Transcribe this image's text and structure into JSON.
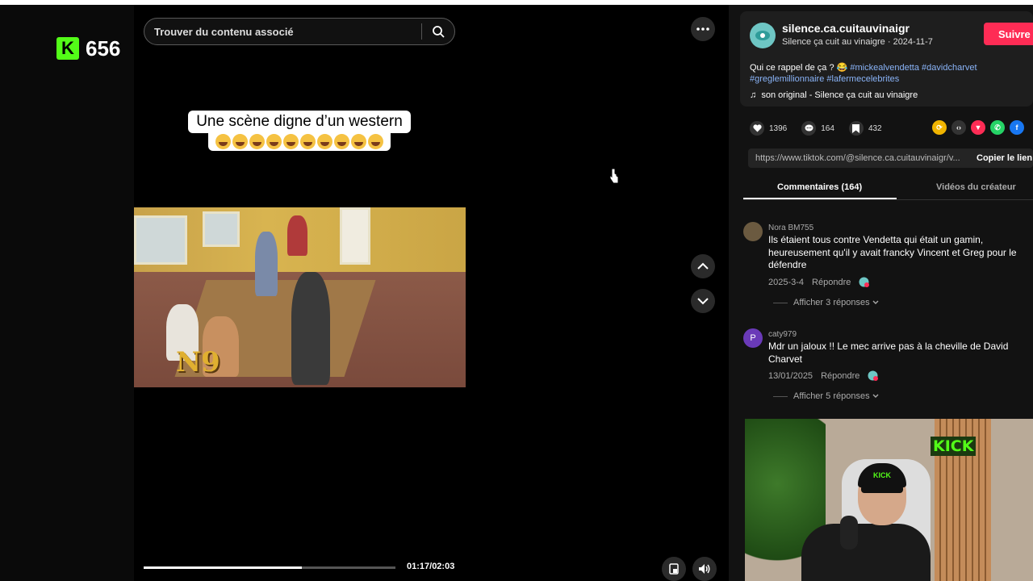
{
  "overlay": {
    "kick_logo_letter": "K",
    "viewer_count": "656"
  },
  "search": {
    "placeholder": "Trouver du contenu associé"
  },
  "video": {
    "caption_line1": "Une scène digne d’un western",
    "caption_emoji_count": 10,
    "watermark": "N9",
    "progress_fraction": 0.628,
    "time": "01:17/02:03"
  },
  "author": {
    "username": "silence.ca.cuitauvinaigr",
    "subtitle": "Silence ça cuit au vinaigre · 2024-11-7",
    "follow_label": "Suivre"
  },
  "description": {
    "text": "Qui ce rappel de ça ? 😂 ",
    "hashtags": [
      "#mickealvendetta",
      "#davidcharvet",
      "#greglemillionnaire",
      "#lafermecelebrites"
    ],
    "music": "son original - Silence ça cuit au vinaigre"
  },
  "stats": {
    "likes": "1396",
    "comments": "164",
    "saves": "432"
  },
  "share_icons": [
    "repost-icon",
    "embed-icon",
    "send-icon",
    "whatsapp-icon",
    "facebook-icon"
  ],
  "link": {
    "url": "https://www.tiktok.com/@silence.ca.cuitauvinaigr/v...",
    "copy_label": "Copier le lien"
  },
  "tabs": {
    "comments": "Commentaires (164)",
    "creator_videos": "Vidéos du créateur"
  },
  "comments": [
    {
      "user": "Nora BM755",
      "text": "Ils étaient tous contre Vendetta qui était un gamin, heureusement qu'il y avait francky Vincent et Greg pour le défendre",
      "date": "2025-3-4",
      "reply_label": "Répondre",
      "show_replies": "Afficher 3 réponses"
    },
    {
      "user": "caty979",
      "avatar_letter": "P",
      "text": "Mdr un jaloux !! Le mec arrive pas à la cheville de David Charvet",
      "date": "13/01/2025",
      "reply_label": "Répondre",
      "show_replies": "Afficher 5 réponses"
    }
  ],
  "webcam": {
    "sign": "KICK",
    "cap_text": "KICK"
  },
  "colors": {
    "accent": "#fe2c55",
    "kick_green": "#53fc18",
    "hashtag": "#8ab4f8"
  }
}
